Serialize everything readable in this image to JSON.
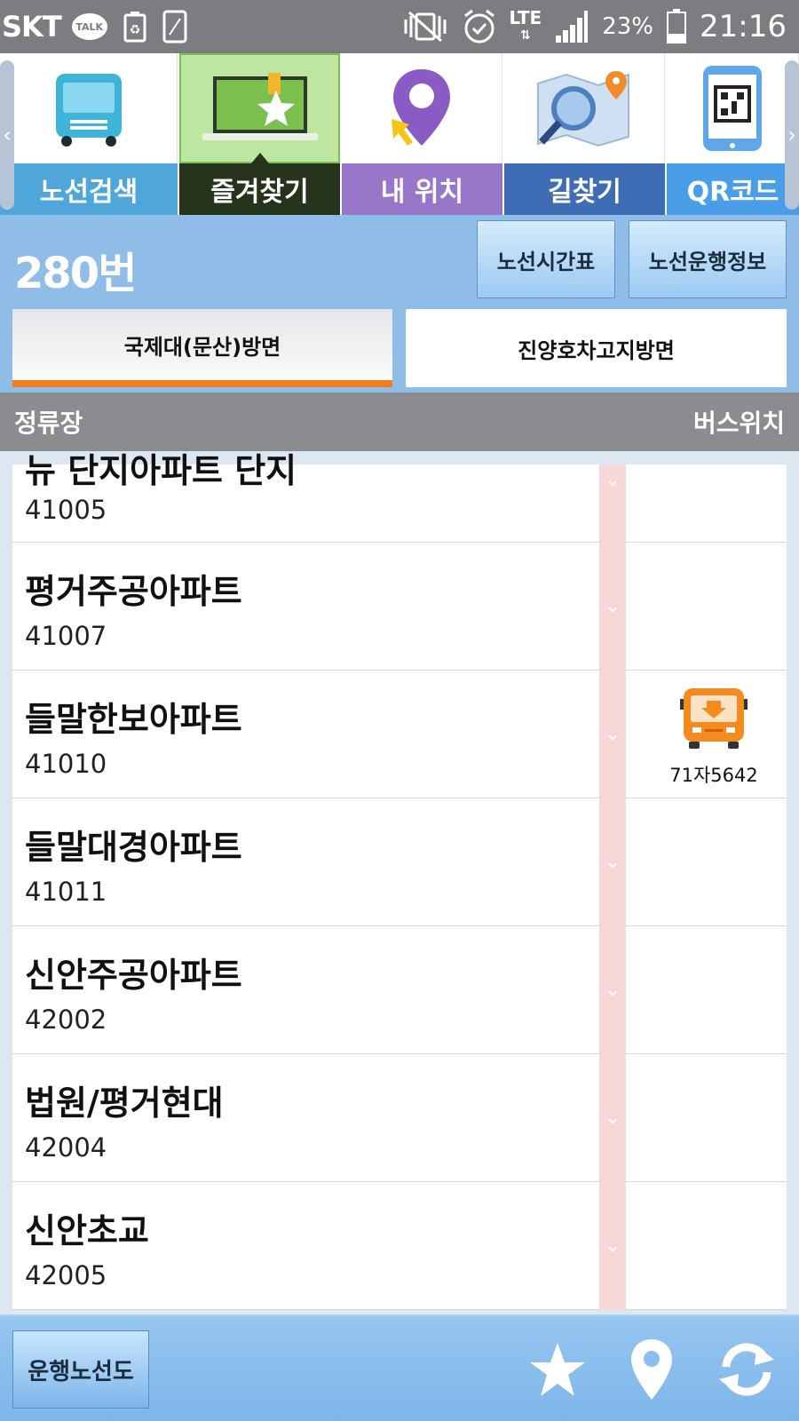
{
  "status_bar": {
    "carrier": "SKT",
    "talk_badge": "TALK",
    "network": "LTE",
    "battery_percent": "23%",
    "time": "21:16"
  },
  "tabs": [
    {
      "label": "노선검색",
      "icon": "bus-icon",
      "color": "#4fa6d8",
      "active": false
    },
    {
      "label": "즐겨찾기",
      "icon": "favorites-laptop-icon",
      "color": "#27341c",
      "active": true
    },
    {
      "label": "내 위치",
      "icon": "location-pin-icon",
      "color": "#9876c9",
      "active": false
    },
    {
      "label": "길찾기",
      "icon": "map-search-icon",
      "color": "#3e6db6",
      "active": false
    },
    {
      "label": "QR코드",
      "icon": "qr-phone-icon",
      "color": "#4a9ee8",
      "active": false
    }
  ],
  "route": {
    "number": "280번",
    "timetable_button": "노선시간표",
    "info_button": "노선운행정보",
    "directions": [
      {
        "label": "국제대(문산)방면",
        "active": true
      },
      {
        "label": "진양호차고지방면",
        "active": false
      }
    ]
  },
  "list_header": {
    "left": "정류장",
    "right": "버스위치"
  },
  "stops": [
    {
      "name": "뉴 단지아파트 단지",
      "code": "41005",
      "bus_plate": ""
    },
    {
      "name": "평거주공아파트",
      "code": "41007",
      "bus_plate": ""
    },
    {
      "name": "들말한보아파트",
      "code": "41010",
      "bus_plate": "71자5642"
    },
    {
      "name": "들말대경아파트",
      "code": "41011",
      "bus_plate": ""
    },
    {
      "name": "신안주공아파트",
      "code": "42002",
      "bus_plate": ""
    },
    {
      "name": "법원/평거현대",
      "code": "42004",
      "bus_plate": ""
    },
    {
      "name": "신안초교",
      "code": "42005",
      "bus_plate": ""
    }
  ],
  "bottom_bar": {
    "route_map_button": "운행노선도",
    "icons": [
      "star-icon",
      "location-pin-icon",
      "refresh-icon"
    ]
  },
  "colors": {
    "accent_orange": "#f07d1e",
    "header_blue": "#8fbde8",
    "track_pink": "#f6d8d8"
  }
}
